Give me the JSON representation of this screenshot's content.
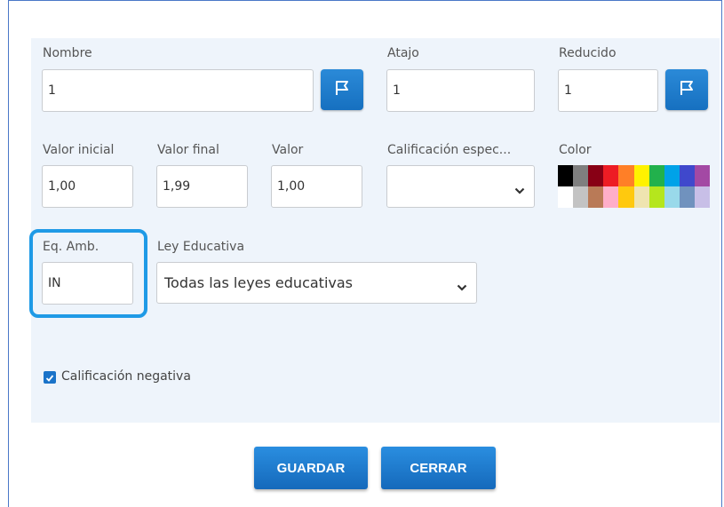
{
  "form": {
    "nombre": {
      "label": "Nombre",
      "value": "1"
    },
    "atajo": {
      "label": "Atajo",
      "value": "1"
    },
    "reducido": {
      "label": "Reducido",
      "value": "1"
    },
    "valor_inicial": {
      "label": "Valor inicial",
      "value": "1,00"
    },
    "valor_final": {
      "label": "Valor final",
      "value": "1,99"
    },
    "valor": {
      "label": "Valor",
      "value": "1,00"
    },
    "calificacion_especial": {
      "label": "Calificación espec...",
      "value": ""
    },
    "color": {
      "label": "Color"
    },
    "eq_amb": {
      "label": "Eq. Amb.",
      "value": "IN"
    },
    "ley_educativa": {
      "label": "Ley Educativa",
      "value": "Todas las leyes educativas"
    },
    "calificacion_negativa": {
      "label": "Calificación negativa",
      "checked": true
    }
  },
  "palette": {
    "row1": [
      "#000000",
      "#7f7f7f",
      "#880015",
      "#ed1c24",
      "#ff7f27",
      "#fff200",
      "#22b14c",
      "#00a2e8",
      "#3f48cc",
      "#a349a4"
    ],
    "row2": [
      "#ffffff",
      "#c3c3c3",
      "#b97a57",
      "#ffaec9",
      "#ffc90e",
      "#efe4b0",
      "#b5e61d",
      "#99d9ea",
      "#7092be",
      "#c8bfe7"
    ]
  },
  "buttons": {
    "guardar": "GUARDAR",
    "cerrar": "CERRAR"
  },
  "icons": {
    "flag": "flag-icon",
    "chevron": "chevron-down-icon",
    "check": "check-icon"
  },
  "colors": {
    "accent": "#1a73c9",
    "highlight": "#1f9ae6",
    "panel": "#eef4fb"
  }
}
